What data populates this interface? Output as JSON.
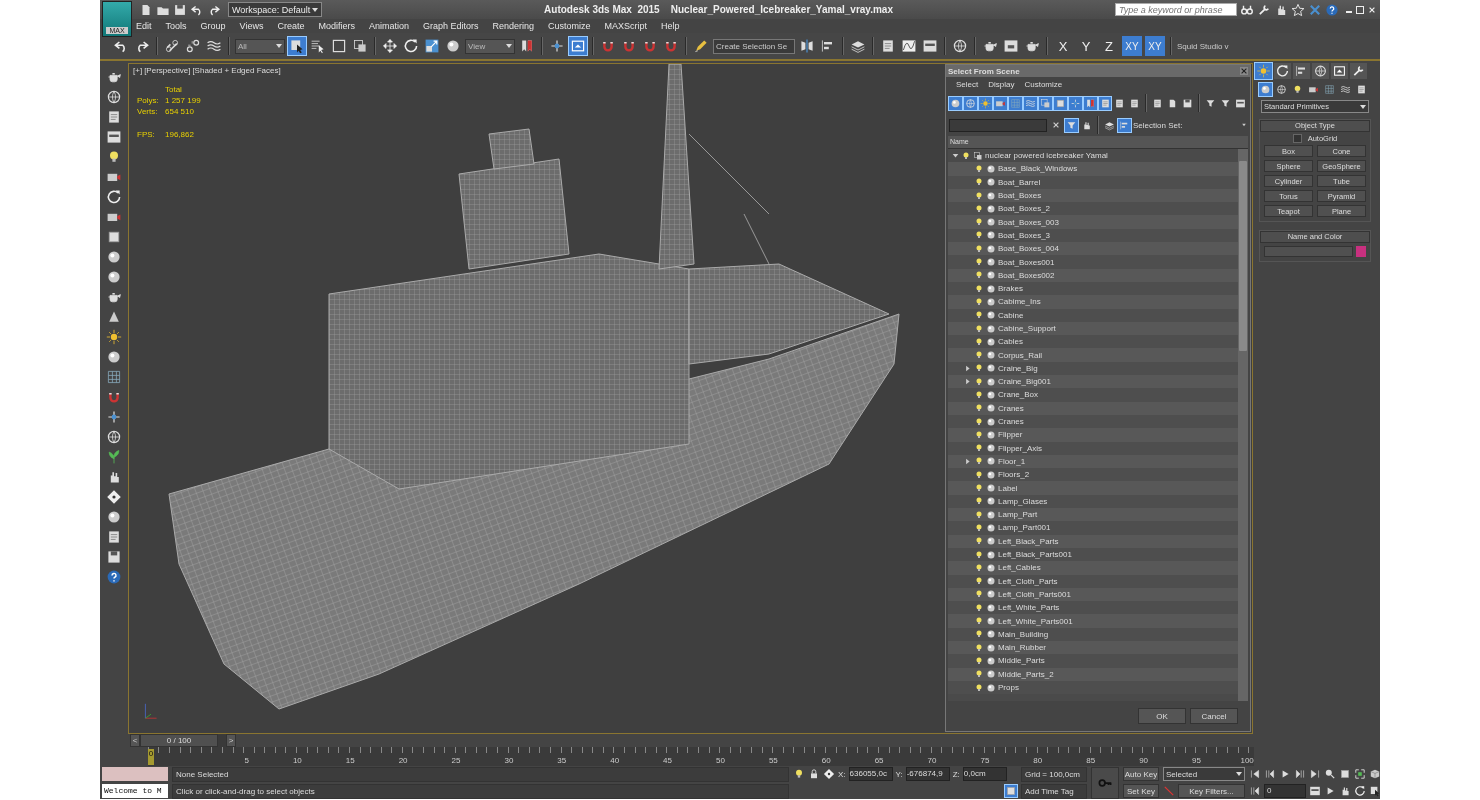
{
  "title_bar": {
    "logo_label": "MAX",
    "workspace": "Workspace: Default",
    "title": "Autodesk 3ds Max  2015    Nuclear_Powered_Icebreaker_Yamal_vray.max",
    "search": {
      "placeholder": "Type a keyword or phrase"
    }
  },
  "menu": [
    "Edit",
    "Tools",
    "Group",
    "Views",
    "Create",
    "Modifiers",
    "Animation",
    "Graph Editors",
    "Rendering",
    "Customize",
    "MAXScript",
    "Help"
  ],
  "main_toolbar": {
    "selection_filter": "All",
    "ref_coord": "View",
    "named_selection": "Create Selection Se",
    "tool_states": [
      false,
      false,
      false,
      false,
      false,
      true,
      false,
      false,
      false,
      false,
      false,
      false,
      false,
      false,
      false,
      true,
      false,
      false,
      false,
      false,
      false,
      false,
      false,
      false,
      false,
      false,
      false,
      false,
      false,
      false,
      false
    ],
    "axis_buttons": [
      {
        "label": "X",
        "selected": false
      },
      {
        "label": "Y",
        "selected": false
      },
      {
        "label": "Z",
        "selected": false
      },
      {
        "label": "XY",
        "selected": true
      },
      {
        "label": "XY",
        "selected": true
      }
    ],
    "studio_label": "Squid Studio v"
  },
  "viewport": {
    "labels": [
      "[+]",
      "[Perspective]",
      "[Shaded + Edged Faces]"
    ],
    "stats_header": "Total",
    "stats": [
      {
        "label": "Polys:",
        "value": "1 257 199"
      },
      {
        "label": "Verts:",
        "value": "654 510"
      }
    ],
    "fps": {
      "label": "FPS:",
      "value": "196,862"
    }
  },
  "scene_dialog": {
    "title": "Select From Scene",
    "menu": [
      "Select",
      "Display",
      "Customize"
    ],
    "filter_states": [
      true,
      true,
      true,
      true,
      true,
      true,
      true,
      true,
      true,
      true,
      true,
      false,
      false
    ],
    "filter_toggle_on": true,
    "selection_set_label": "Selection Set:",
    "column": "Name",
    "root": {
      "name": "nuclear powered icebreaker Yamal",
      "expanded": true,
      "children": [
        {
          "name": "Base_Black_Windows",
          "expandable": false
        },
        {
          "name": "Boat_Barrel",
          "expandable": false
        },
        {
          "name": "Boat_Boxes",
          "expandable": false
        },
        {
          "name": "Boat_Boxes_2",
          "expandable": false
        },
        {
          "name": "Boat_Boxes_003",
          "expandable": false
        },
        {
          "name": "Boat_Boxes_3",
          "expandable": false
        },
        {
          "name": "Boat_Boxes_004",
          "expandable": false
        },
        {
          "name": "Boat_Boxes001",
          "expandable": false
        },
        {
          "name": "Boat_Boxes002",
          "expandable": false
        },
        {
          "name": "Brakes",
          "expandable": false
        },
        {
          "name": "Cabime_Ins",
          "expandable": false
        },
        {
          "name": "Cabine",
          "expandable": false
        },
        {
          "name": "Cabine_Support",
          "expandable": false
        },
        {
          "name": "Cables",
          "expandable": false
        },
        {
          "name": "Corpus_Rail",
          "expandable": false
        },
        {
          "name": "Craine_Big",
          "expandable": true
        },
        {
          "name": "Craine_Big001",
          "expandable": true
        },
        {
          "name": "Crane_Box",
          "expandable": false
        },
        {
          "name": "Cranes",
          "expandable": false
        },
        {
          "name": "Cranes",
          "expandable": false
        },
        {
          "name": "Flipper",
          "expandable": false
        },
        {
          "name": "Flipper_Axis",
          "expandable": false
        },
        {
          "name": "Floor_1",
          "expandable": true
        },
        {
          "name": "Floors_2",
          "expandable": false
        },
        {
          "name": "Label",
          "expandable": false
        },
        {
          "name": "Lamp_Glases",
          "expandable": false
        },
        {
          "name": "Lamp_Part",
          "expandable": false
        },
        {
          "name": "Lamp_Part001",
          "expandable": false
        },
        {
          "name": "Left_Black_Parts",
          "expandable": false
        },
        {
          "name": "Left_Black_Parts001",
          "expandable": false
        },
        {
          "name": "Left_Cables",
          "expandable": false
        },
        {
          "name": "Left_Cloth_Parts",
          "expandable": false
        },
        {
          "name": "Left_Cloth_Parts001",
          "expandable": false
        },
        {
          "name": "Left_White_Parts",
          "expandable": false
        },
        {
          "name": "Left_White_Parts001",
          "expandable": false
        },
        {
          "name": "Main_Building",
          "expandable": false
        },
        {
          "name": "Main_Rubber",
          "expandable": false
        },
        {
          "name": "Middle_Parts",
          "expandable": false
        },
        {
          "name": "Middle_Parts_2",
          "expandable": false
        },
        {
          "name": "Props",
          "expandable": false
        }
      ]
    },
    "buttons": [
      "OK",
      "Cancel"
    ]
  },
  "command_panel": {
    "tabs": [
      {
        "selected": true
      },
      {
        "selected": false
      },
      {
        "selected": false
      },
      {
        "selected": false
      },
      {
        "selected": false
      },
      {
        "selected": false
      }
    ],
    "categories": [
      {
        "selected": true
      },
      {
        "selected": false
      },
      {
        "selected": false
      },
      {
        "selected": false
      },
      {
        "selected": false
      },
      {
        "selected": false
      },
      {
        "selected": false
      }
    ],
    "dropdown": "Standard Primitives",
    "object_type": {
      "title": "Object Type",
      "autogrid": {
        "label": "AutoGrid",
        "checked": false
      },
      "buttons": [
        "Box",
        "Cone",
        "Sphere",
        "GeoSphere",
        "Cylinder",
        "Tube",
        "Torus",
        "Pyramid",
        "Teapot",
        "Plane"
      ]
    },
    "name_and_color": {
      "title": "Name and Color",
      "color": "#c8307f"
    }
  },
  "time_slider": {
    "label": "0 / 100",
    "prev": "<",
    "next": ">"
  },
  "ruler": {
    "current_frame": "0",
    "labels": [
      "5",
      "10",
      "15",
      "20",
      "25",
      "30",
      "35",
      "40",
      "45",
      "50",
      "55",
      "60",
      "65",
      "70",
      "75",
      "80",
      "85",
      "90",
      "95",
      "100"
    ]
  },
  "status": {
    "listener": "Welcome to M",
    "selection": "None Selected",
    "prompt": "Click or click-and-drag to select objects",
    "coords": [
      {
        "label": "X:",
        "value": "636055,0c"
      },
      {
        "label": "Y:",
        "value": "-676874,9"
      },
      {
        "label": "Z:",
        "value": "0,0cm"
      }
    ],
    "grid": "Grid = 100,0cm",
    "time_tag": "Add Time Tag",
    "auto_key": "Auto Key",
    "set_key": "Set Key",
    "key_mode": "Selected",
    "key_filters": "Key Filters...",
    "frame": "0"
  }
}
